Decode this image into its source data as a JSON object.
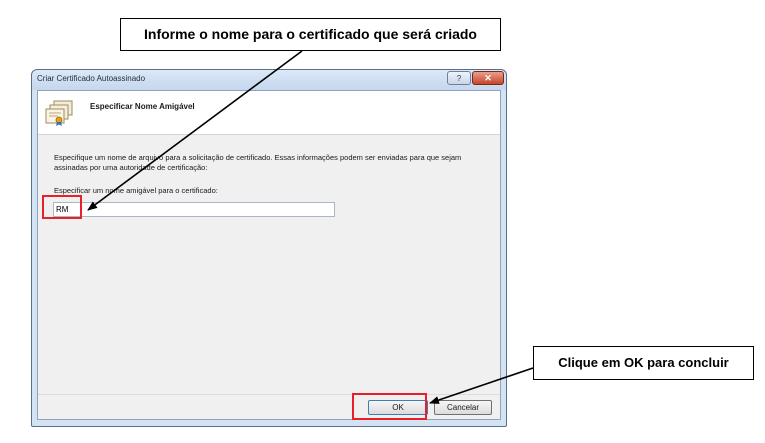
{
  "dialog": {
    "title": "Criar Certificado Autoassinado",
    "help_label": "?",
    "close_label": "✕",
    "header_title": "Especificar Nome Amigável",
    "description": "Especifique um nome de arquivo para a solicitação de certificado. Essas informações podem ser enviadas para que sejam assinadas por uma autoridade de certificação:",
    "field_label": "Especificar um nome amigável para o certificado:",
    "field_value": "RM",
    "ok_label": "OK",
    "cancel_label": "Cancelar"
  },
  "annotations": {
    "callout_name": "Informe o nome para o certificado que será criado",
    "callout_ok": "Clique em OK para concluir"
  },
  "icons": {
    "header_icon": "certificate-stack-icon"
  },
  "colors": {
    "highlight": "#e8202a",
    "close_button": "#c7452b",
    "window_frame": "#d3e3f4"
  }
}
